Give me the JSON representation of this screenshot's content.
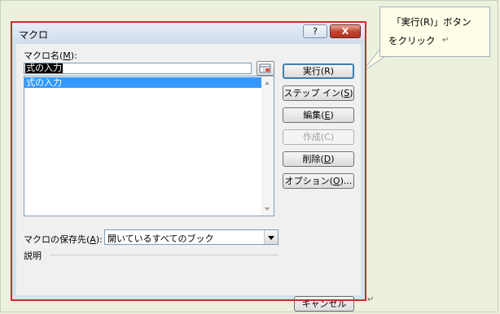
{
  "dialog": {
    "title": "マクロ",
    "help_label": "?",
    "close_label": "X",
    "macro_name": {
      "label_pre": "マクロ名(",
      "label_key": "M",
      "label_post": "):",
      "value": "式の入力"
    },
    "list_items": [
      "式の入力"
    ],
    "buttons": {
      "run": "実行(R)",
      "step_in": {
        "pre": "ステップ イン(",
        "key": "S",
        "post": ")"
      },
      "edit": {
        "pre": "編集(",
        "key": "E",
        "post": ")"
      },
      "create": "作成(C)",
      "delete": {
        "pre": "削除(",
        "key": "D",
        "post": ")"
      },
      "options": {
        "pre": "オプション(",
        "key": "O",
        "post": ")..."
      },
      "cancel": "キャンセル"
    },
    "store_in": {
      "label_pre": "マクロの保存先(",
      "label_key": "A",
      "label_post": "):",
      "value": "開いているすべてのブック"
    },
    "description_label": "説明"
  },
  "callout": {
    "line1": "「実行(R)」ボタン",
    "line2": "をクリック"
  },
  "para_mark": "↵"
}
